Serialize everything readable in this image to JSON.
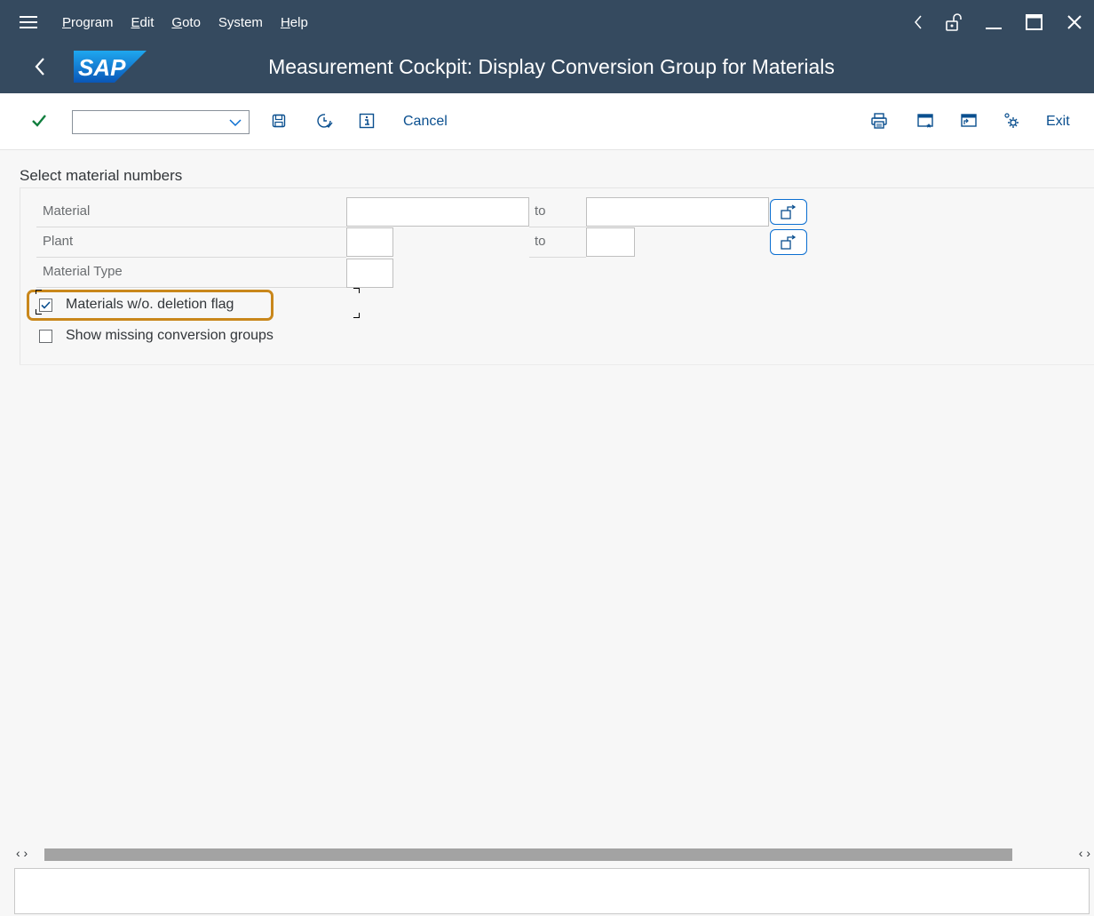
{
  "menubar": {
    "items": [
      {
        "label": "Program",
        "accel": "P",
        "rest": "rogram"
      },
      {
        "label": "Edit",
        "accel": "E",
        "rest": "dit"
      },
      {
        "label": "Goto",
        "accel": "G",
        "rest": "oto"
      },
      {
        "label": "System",
        "accel": "",
        "rest": "System"
      },
      {
        "label": "Help",
        "accel": "H",
        "rest": "elp"
      }
    ]
  },
  "titlebar": {
    "logo_text": "SAP",
    "title": "Measurement Cockpit: Display Conversion Group for Materials"
  },
  "toolbar": {
    "command_value": "",
    "cancel_label": "Cancel",
    "exit_label": "Exit"
  },
  "form": {
    "section_title": "Select material numbers",
    "rows": [
      {
        "label": "Material",
        "from": "",
        "to_label": "to",
        "to": ""
      },
      {
        "label": "Plant",
        "from": "",
        "to_label": "to",
        "to": ""
      },
      {
        "label": "Material Type",
        "from": ""
      }
    ],
    "checkboxes": [
      {
        "label": "Materials w/o. deletion flag",
        "checked": true
      },
      {
        "label": "Show missing conversion groups",
        "checked": false
      }
    ]
  },
  "colors": {
    "shell": "#354a5f",
    "accent": "#0a6ed1",
    "highlight": "#c9871b",
    "ok_check": "#107e3e"
  }
}
